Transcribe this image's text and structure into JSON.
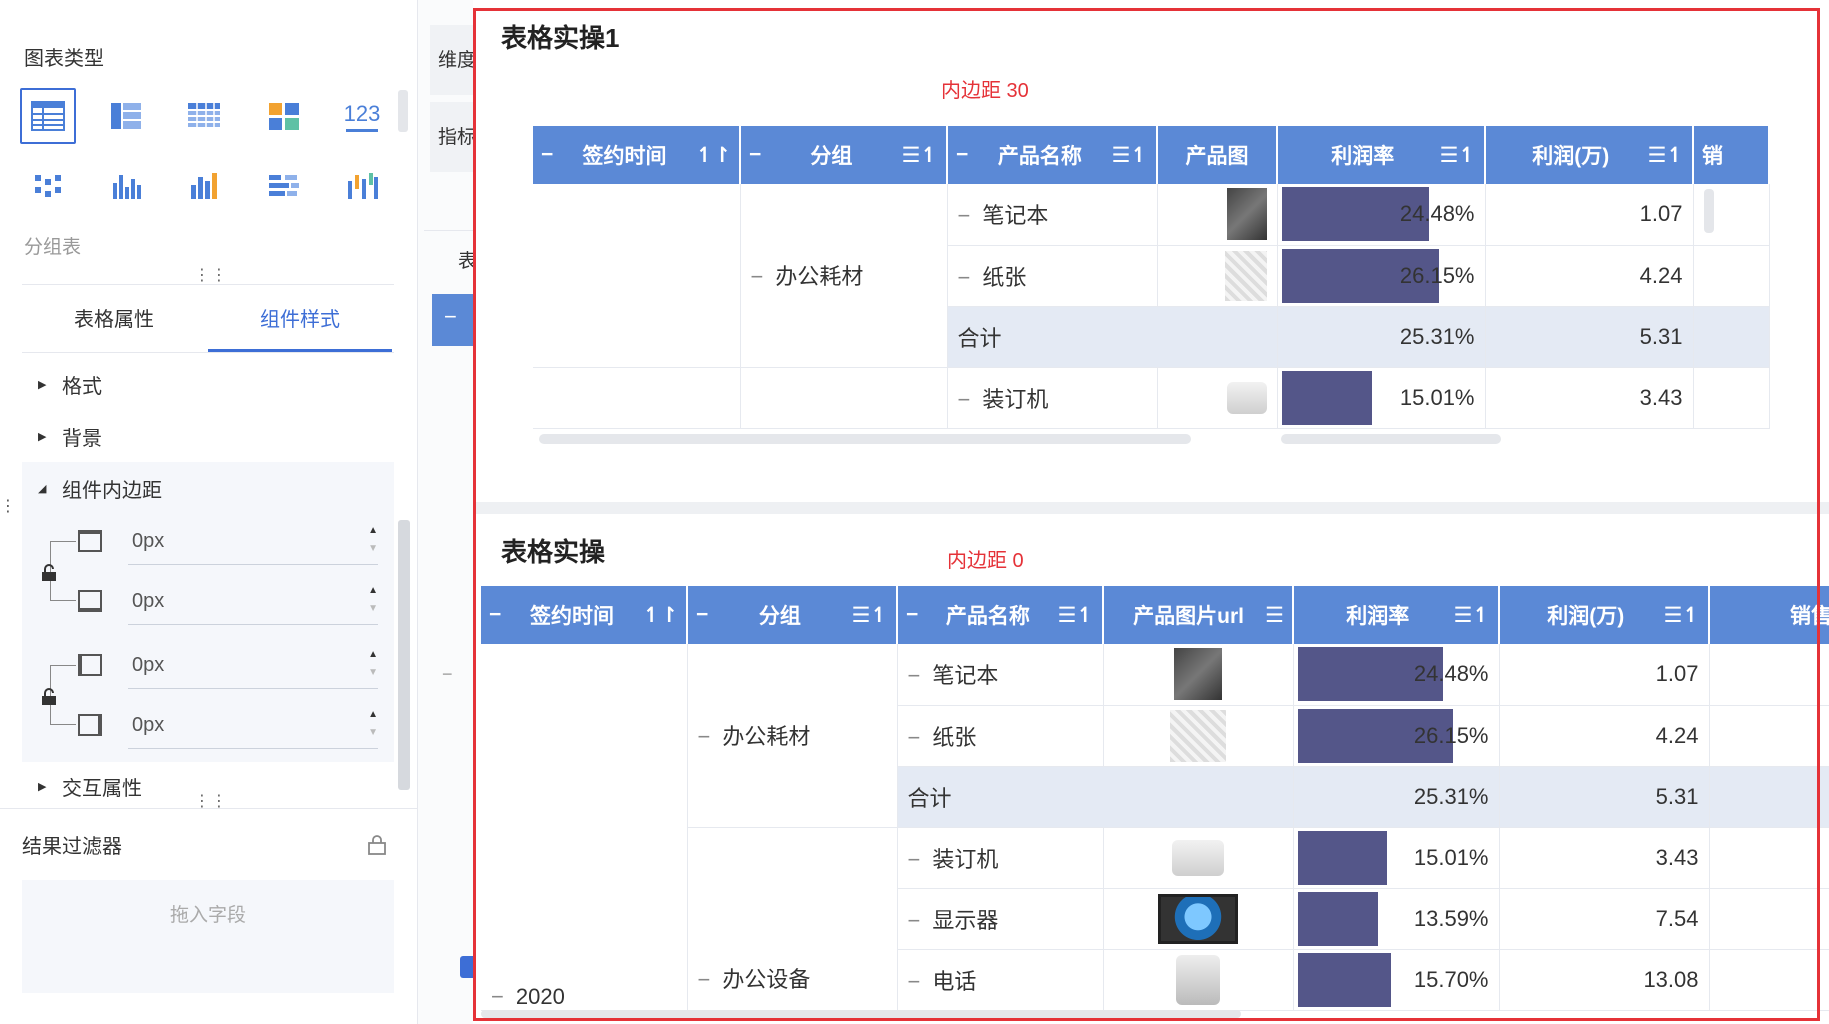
{
  "left_panel": {
    "chart_type_label": "图表类型",
    "chart_icons": [
      "table-icon",
      "group-table-icon",
      "cross-table-icon",
      "dashboard-card-icon",
      "number-icon",
      "scatter-grid-icon",
      "column-chart-icon",
      "bar-chart-icon",
      "horizontal-bar-icon",
      "waterfall-icon"
    ],
    "number_icon_text": "123",
    "selected_subtitle": "分组表",
    "tabs": [
      "表格属性",
      "组件样式"
    ],
    "active_tab": "组件样式",
    "items": {
      "format": "格式",
      "background": "背景",
      "padding": "组件内边距",
      "interaction": "交互属性"
    },
    "padding_values": [
      "0px",
      "0px",
      "0px",
      "0px"
    ],
    "filter_title": "结果过滤器",
    "filter_placeholder": "拖入字段"
  },
  "mid": {
    "dim": "维度",
    "metric": "指标",
    "tab_fragment": "表",
    "collapse": "−"
  },
  "card1": {
    "title": "表格实操1",
    "note": "内边距 30",
    "headers": [
      "签约时间",
      "分组",
      "产品名称",
      "产品图",
      "利润率",
      "利润(万)",
      "销"
    ],
    "group": "办公耗材",
    "rows": [
      {
        "product": "笔记本",
        "rate": "24.48%",
        "rate_value": 24.48,
        "profit": "1.07"
      },
      {
        "product": "纸张",
        "rate": "26.15%",
        "rate_value": 26.15,
        "profit": "4.24"
      },
      {
        "total_label": "合计",
        "rate": "25.31%",
        "profit": "5.31"
      },
      {
        "product": "装订机",
        "rate": "15.01%",
        "rate_value": 15.01,
        "profit": "3.43"
      }
    ]
  },
  "card2": {
    "title": "表格实操",
    "note": "内边距 0",
    "headers": [
      "签约时间",
      "分组",
      "产品名称",
      "产品图片url",
      "利润率",
      "利润(万)",
      "销售"
    ],
    "groups": [
      "办公耗材",
      "办公设备"
    ],
    "year": "2020",
    "rows": [
      {
        "product": "笔记本",
        "rate": "24.48%",
        "rate_value": 24.48,
        "profit": "1.07"
      },
      {
        "product": "纸张",
        "rate": "26.15%",
        "rate_value": 26.15,
        "profit": "4.24"
      },
      {
        "total_label": "合计",
        "rate": "25.31%",
        "profit": "5.31"
      },
      {
        "product": "装订机",
        "rate": "15.01%",
        "rate_value": 15.01,
        "profit": "3.43"
      },
      {
        "product": "显示器",
        "rate": "13.59%",
        "rate_value": 13.59,
        "profit": "7.54"
      },
      {
        "product": "电话",
        "rate": "15.70%",
        "rate_value": 15.7,
        "profit": "13.08"
      }
    ]
  },
  "colors": {
    "accent": "#3d6ed6",
    "header": "#5b89d6",
    "bar": "#545689",
    "frame": "#e53238",
    "total_row": "#e4eaf4"
  }
}
